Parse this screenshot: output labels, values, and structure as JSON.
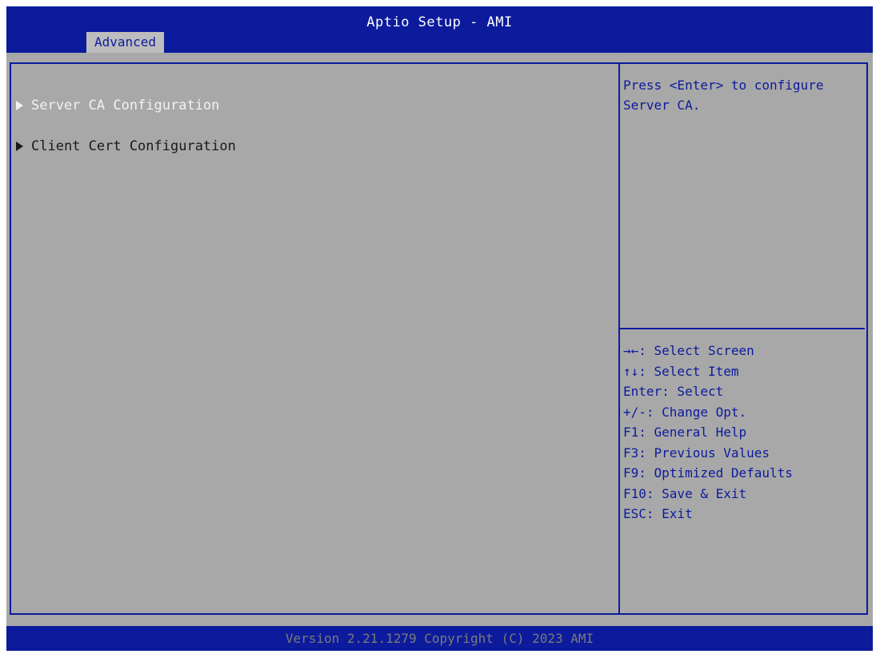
{
  "header": {
    "title": "Aptio Setup - AMI",
    "tabs": [
      {
        "label": "Advanced",
        "active": true
      }
    ]
  },
  "menu": {
    "items": [
      {
        "label": "Server CA Configuration",
        "selected": true
      },
      {
        "label": "Client Cert Configuration",
        "selected": false
      }
    ]
  },
  "help": {
    "text": "Press <Enter> to configure Server CA."
  },
  "keys": [
    "→←: Select Screen",
    "↑↓: Select Item",
    "Enter: Select",
    "+/-: Change Opt.",
    "F1: General Help",
    "F3: Previous Values",
    "F9: Optimized Defaults",
    "F10: Save & Exit",
    "ESC: Exit"
  ],
  "footer": {
    "version": "Version 2.21.1279 Copyright (C) 2023 AMI"
  },
  "colors": {
    "header_bg": "#0c1b9c",
    "body_bg": "#a8a8a8",
    "help_text": "#0c1b9c",
    "selected_text": "#f2f2f2"
  }
}
